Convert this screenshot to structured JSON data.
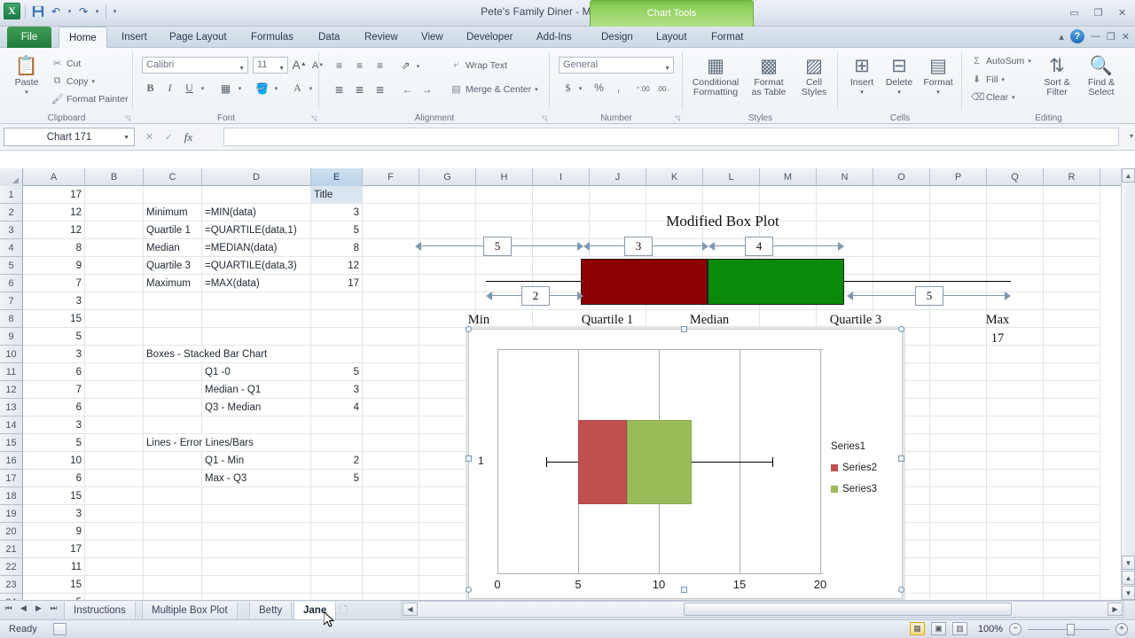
{
  "titlebar": {
    "document_title": "Pete's Family Diner  -  Microsoft Excel",
    "logo": "X",
    "quick_access": [
      {
        "name": "save-icon",
        "glyph": "■"
      },
      {
        "name": "undo-icon",
        "glyph": "↶"
      },
      {
        "name": "redo-icon",
        "glyph": "↷"
      },
      {
        "name": "customize-qat-icon",
        "glyph": "▾"
      }
    ],
    "window_controls": [
      {
        "name": "minimize-window-button",
        "glyph": "—"
      },
      {
        "name": "restore-window-button",
        "glyph": "□"
      },
      {
        "name": "close-window-button",
        "glyph": "✕"
      }
    ],
    "context_tools_label": "Chart Tools"
  },
  "ribbon_tabs": [
    {
      "label": "File",
      "active": false,
      "file": true
    },
    {
      "label": "Home",
      "active": true
    },
    {
      "label": "Insert",
      "active": false
    },
    {
      "label": "Page Layout",
      "active": false
    },
    {
      "label": "Formulas",
      "active": false
    },
    {
      "label": "Data",
      "active": false
    },
    {
      "label": "Review",
      "active": false
    },
    {
      "label": "View",
      "active": false
    },
    {
      "label": "Developer",
      "active": false
    },
    {
      "label": "Add-Ins",
      "active": false
    },
    {
      "label": "Design",
      "active": false,
      "context": true
    },
    {
      "label": "Layout",
      "active": false,
      "context": true
    },
    {
      "label": "Format",
      "active": false,
      "context": true
    }
  ],
  "ribbon_help": {
    "minimize_ribbon": "▴",
    "help": "?",
    "doc_minimize": "—",
    "doc_restore": "❐",
    "doc_close": "✕"
  },
  "ribbon": {
    "clipboard": {
      "group_label": "Clipboard",
      "paste_label": "Paste",
      "items": [
        {
          "label": "Cut",
          "icon": "scissors-icon",
          "glyph": "✂"
        },
        {
          "label": "Copy",
          "icon": "copy-icon",
          "glyph": "⧉"
        },
        {
          "label": "Format Painter",
          "icon": "paintbrush-icon",
          "glyph": "✎"
        }
      ]
    },
    "font": {
      "group_label": "Font",
      "font_name": "Calibri",
      "font_size": "11",
      "grow_font": "A",
      "shrink_font": "A",
      "bold": "B",
      "italic": "I",
      "underline": "U",
      "borders": "▦",
      "fill_color": "A",
      "font_color": "A"
    },
    "alignment": {
      "group_label": "Alignment",
      "wrap_text": "Wrap Text",
      "merge_center": "Merge & Center",
      "orientation_icon": "orientation-icon",
      "decrease_indent": "←",
      "increase_indent": "→"
    },
    "number": {
      "group_label": "Number",
      "format_value": "General",
      "currency": "$",
      "percent": "%",
      "comma": ",",
      "increase_decimal": ".00",
      "decrease_decimal": ".00"
    },
    "styles": {
      "group_label": "Styles",
      "items": [
        {
          "line1": "Conditional",
          "line2": "Formatting"
        },
        {
          "line1": "Format",
          "line2": "as Table"
        },
        {
          "line1": "Cell",
          "line2": "Styles"
        }
      ]
    },
    "cells": {
      "group_label": "Cells",
      "items": [
        {
          "label": "Insert"
        },
        {
          "label": "Delete"
        },
        {
          "label": "Format"
        }
      ]
    },
    "editing": {
      "group_label": "Editing",
      "autosum": "AutoSum",
      "fill": "Fill",
      "clear": "Clear",
      "sort_filter_l1": "Sort &",
      "sort_filter_l2": "Filter",
      "find_select_l1": "Find &",
      "find_select_l2": "Select"
    }
  },
  "formula_bar": {
    "name_box_value": "Chart 171",
    "formula_value": "",
    "cancel_icon": "✕",
    "enter_icon": "✓",
    "function_icon": "fx"
  },
  "grid": {
    "columns": [
      "A",
      "B",
      "C",
      "D",
      "E",
      "F",
      "G",
      "H",
      "I",
      "J",
      "K",
      "L",
      "M",
      "N",
      "O",
      "P",
      "Q",
      "R"
    ],
    "selected_column": "E",
    "row_numbers": [
      1,
      2,
      3,
      4,
      5,
      6,
      7,
      8,
      9,
      10,
      11,
      12,
      13,
      14,
      15,
      16,
      17,
      18,
      19,
      20,
      21,
      22,
      23,
      24
    ],
    "rows": [
      {
        "A": "17",
        "C": "",
        "D": "",
        "E": "Title",
        "E_header": true
      },
      {
        "A": "12",
        "C": "Minimum",
        "D": "=MIN(data)",
        "E": "3"
      },
      {
        "A": "12",
        "C": "Quartile 1",
        "D": "=QUARTILE(data,1)",
        "E": "5"
      },
      {
        "A": "8",
        "C": "Median",
        "D": "=MEDIAN(data)",
        "E": "8"
      },
      {
        "A": "9",
        "C": "Quartile 3",
        "D": "=QUARTILE(data,3)",
        "E": "12"
      },
      {
        "A": "7",
        "C": "Maximum",
        "D": "=MAX(data)",
        "E": "17"
      },
      {
        "A": "3",
        "C": "",
        "D": "",
        "E": ""
      },
      {
        "A": "15",
        "C": "",
        "D": "",
        "E": ""
      },
      {
        "A": "5",
        "C": "",
        "D": "",
        "E": ""
      },
      {
        "A": "3",
        "C": "Boxes - Stacked Bar Chart",
        "C_wide": true,
        "D": "",
        "E": ""
      },
      {
        "A": "6",
        "C": "",
        "D": "Q1 -0",
        "E": "5"
      },
      {
        "A": "7",
        "C": "",
        "D": "Median - Q1",
        "E": "3"
      },
      {
        "A": "6",
        "C": "",
        "D": "Q3 - Median",
        "E": "4"
      },
      {
        "A": "3",
        "C": "",
        "D": "",
        "E": ""
      },
      {
        "A": "5",
        "C": "Lines - Error Lines/Bars",
        "C_wide": true,
        "D": "",
        "E": ""
      },
      {
        "A": "10",
        "C": "",
        "D": "Q1 - Min",
        "E": "2"
      },
      {
        "A": "6",
        "C": "",
        "D": "Max - Q3",
        "E": "5"
      },
      {
        "A": "15",
        "C": "",
        "D": "",
        "E": ""
      },
      {
        "A": "3",
        "C": "",
        "D": "",
        "E": ""
      },
      {
        "A": "9",
        "C": "",
        "D": "",
        "E": ""
      },
      {
        "A": "17",
        "C": "",
        "D": "",
        "E": ""
      },
      {
        "A": "11",
        "C": "",
        "D": "",
        "E": ""
      },
      {
        "A": "15",
        "C": "",
        "D": "",
        "E": ""
      },
      {
        "A": "5",
        "C": "",
        "D": "",
        "E": ""
      }
    ]
  },
  "diagram": {
    "title": "Modified Box Plot",
    "box_left_color": "#8b0000",
    "box_right_color": "#0a8a08",
    "top_spans": [
      {
        "value": "5",
        "label": "min-to-q1-span"
      },
      {
        "value": "3",
        "label": "q1-to-median-span"
      },
      {
        "value": "4",
        "label": "median-to-q3-span"
      }
    ],
    "bottom_spans": [
      {
        "value": "2",
        "label": "q1-minus-min-span"
      },
      {
        "value": "5",
        "label": "max-minus-q3-span"
      }
    ],
    "axis_labels": [
      "Min",
      "Quartile 1",
      "Median",
      "Quartile 3",
      "Max"
    ],
    "max_value": "17"
  },
  "chart_data": {
    "type": "bar",
    "title": "",
    "xlabel": "",
    "ylabel": "",
    "orientation": "horizontal",
    "categories": [
      "1"
    ],
    "xticks": [
      "0",
      "5",
      "10",
      "15",
      "20"
    ],
    "xlim": [
      0,
      20
    ],
    "grid": true,
    "legend_position": "right",
    "legend": [
      "Series1",
      "Series2",
      "Series3"
    ],
    "legend_colors": [
      "#ffffff",
      "#c0504d",
      "#9bbb59"
    ],
    "series": [
      {
        "name": "Series1",
        "values": [
          5
        ],
        "color": "#ffffff",
        "note": "invisible spacer bar 0 to Q1"
      },
      {
        "name": "Series2",
        "values": [
          3
        ],
        "color": "#c0504d",
        "note": "Q1 to Median"
      },
      {
        "name": "Series3",
        "values": [
          4
        ],
        "color": "#9bbb59",
        "note": "Median to Q3"
      }
    ],
    "box_plot": {
      "min": 3,
      "q1": 5,
      "median": 8,
      "q3": 12,
      "max": 17
    },
    "whisker_low": 3,
    "whisker_high": 17,
    "selected": true
  },
  "sheet_tabs": {
    "nav": [
      "⏮",
      "◀",
      "▶",
      "⏭"
    ],
    "tabs": [
      {
        "label": "Instructions",
        "active": false
      },
      {
        "label": "Multiple Box Plot",
        "active": false
      },
      {
        "label": "Betty",
        "active": false
      },
      {
        "label": "Jane",
        "active": true
      }
    ],
    "new_sheet_icon": "new-sheet-icon"
  },
  "status_bar": {
    "status_text": "Ready",
    "view_buttons": [
      {
        "name": "normal-view-button",
        "glyph": "▦",
        "active": true
      },
      {
        "name": "page-layout-view-button",
        "glyph": "▣",
        "active": false
      },
      {
        "name": "page-break-preview-button",
        "glyph": "▥",
        "active": false
      }
    ],
    "zoom_level": "100%",
    "zoom_out": "−",
    "zoom_in": "+"
  }
}
